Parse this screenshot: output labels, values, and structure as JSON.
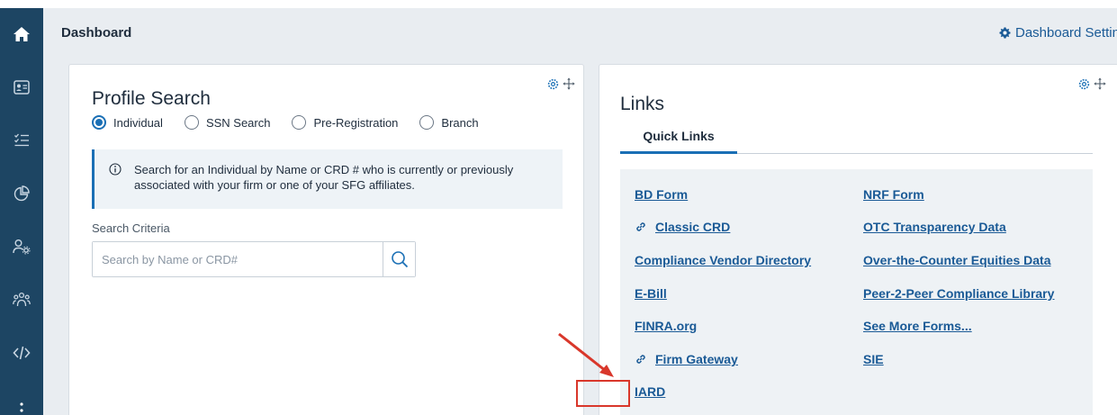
{
  "app": {
    "title": "Dashboard",
    "settings_label": "Dashboard Setting"
  },
  "sidebar": {
    "items": [
      {
        "icon": "home-icon"
      },
      {
        "icon": "profile-card-icon"
      },
      {
        "icon": "checklist-icon"
      },
      {
        "icon": "pie-chart-icon"
      },
      {
        "icon": "user-settings-icon"
      },
      {
        "icon": "people-group-icon"
      },
      {
        "icon": "code-icon"
      },
      {
        "icon": "more-vertical-icon"
      }
    ]
  },
  "profile_search": {
    "title": "Profile Search",
    "radios": [
      {
        "label": "Individual",
        "selected": true
      },
      {
        "label": "SSN Search",
        "selected": false
      },
      {
        "label": "Pre-Registration",
        "selected": false
      },
      {
        "label": "Branch",
        "selected": false
      }
    ],
    "info": "Search for an Individual by Name or CRD # who is currently or previously associated with your firm or one of your SFG affiliates.",
    "criteria_label": "Search Criteria",
    "search_placeholder": "Search by Name or CRD#",
    "search_value": ""
  },
  "links": {
    "title": "Links",
    "tabs": [
      {
        "label": "Quick Links",
        "active": true
      }
    ],
    "left_column": [
      {
        "label": "BD Form",
        "external": false
      },
      {
        "label": "Classic CRD",
        "external": true
      },
      {
        "label": "Compliance Vendor Directory",
        "external": false
      },
      {
        "label": "E-Bill",
        "external": false
      },
      {
        "label": "FINRA.org",
        "external": false
      },
      {
        "label": "Firm Gateway",
        "external": true
      },
      {
        "label": "IARD",
        "external": false,
        "highlighted": true
      }
    ],
    "right_column": [
      {
        "label": "NRF Form",
        "external": false
      },
      {
        "label": "OTC Transparency Data",
        "external": false
      },
      {
        "label": "Over-the-Counter Equities Data",
        "external": false
      },
      {
        "label": "Peer-2-Peer Compliance Library",
        "external": false
      },
      {
        "label": "See More Forms...",
        "external": false
      },
      {
        "label": "SIE",
        "external": false
      }
    ]
  },
  "colors": {
    "sidebar": "#1d4563",
    "accent": "#1a6fb5",
    "link": "#1a5a96",
    "annotation": "#d9372b"
  }
}
